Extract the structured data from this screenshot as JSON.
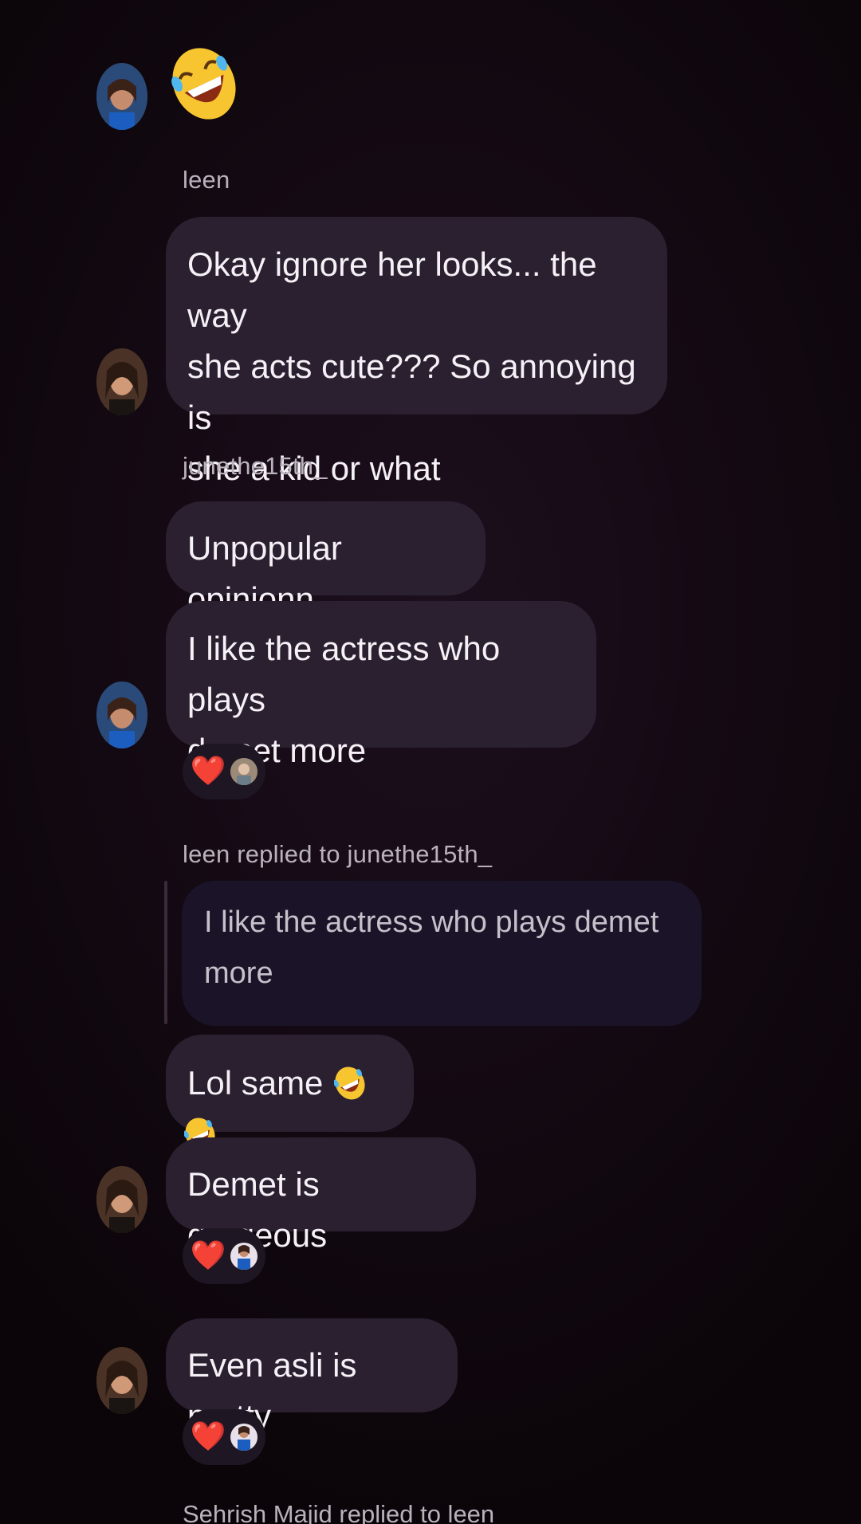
{
  "chat": {
    "messages": [
      {
        "id": "m1",
        "type": "emoji",
        "emoji_name": "rolling-on-floor-laughing"
      },
      {
        "id": "m2",
        "sender": "leen",
        "lines": [
          "Okay ignore her looks... the way",
          "she acts cute??? So annoying is",
          "she a kid or what"
        ]
      },
      {
        "id": "m3",
        "sender": "junethe15th_",
        "text": "Unpopular opinionn"
      },
      {
        "id": "m4",
        "lines": [
          "I like the actress who plays",
          "demet more"
        ],
        "reaction": "❤️"
      },
      {
        "id": "m5",
        "reply_header": "leen replied to junethe15th_",
        "quote_lines": [
          "I like the actress who plays demet",
          "more"
        ]
      },
      {
        "id": "m6",
        "text": "Lol same",
        "emoji_name": "rolling-on-floor-laughing"
      },
      {
        "id": "m7",
        "text": "Demet is gorgeous",
        "reaction": "❤️"
      },
      {
        "id": "m8",
        "text": "Even asli is pretty",
        "reaction": "❤️"
      },
      {
        "id": "m9",
        "reply_header": "Sehrish Majid replied to leen"
      }
    ]
  },
  "icons": {
    "avatar": "avatar",
    "emoji": "rolling-on-floor-laughing-emoji",
    "heart": "heart-icon"
  },
  "colors": {
    "background": "#130912",
    "bubble": "#2a2030",
    "quote_bubble": "#1b1428",
    "heart": "#e0252c",
    "sender_text": "#b9b2bd"
  }
}
